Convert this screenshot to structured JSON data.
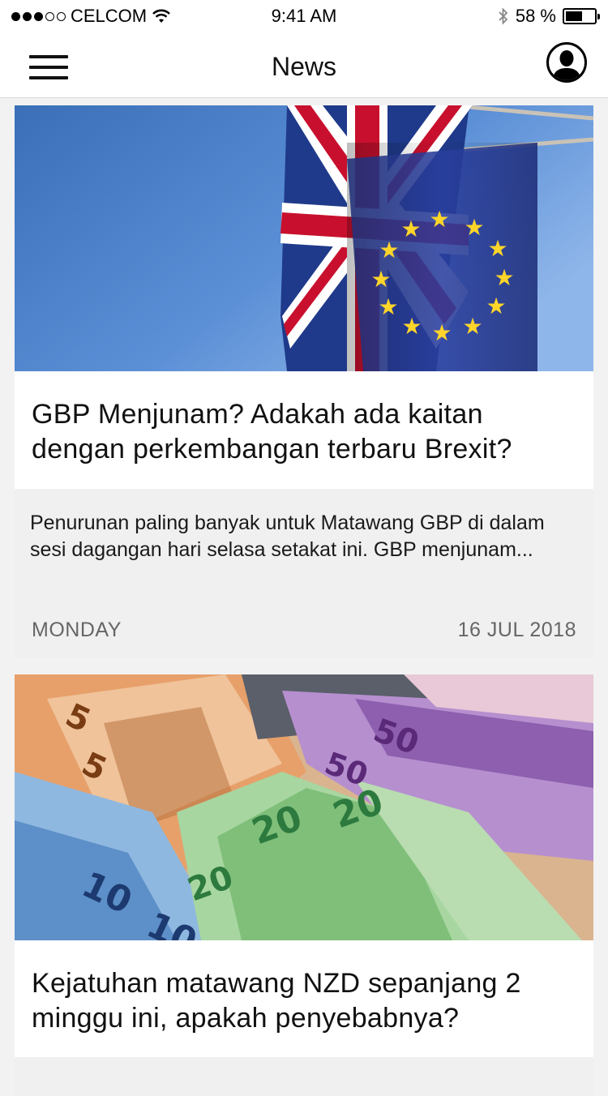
{
  "status_bar": {
    "carrier": "CELCOM",
    "time": "9:41 AM",
    "battery_percent": "58 %",
    "battery_level": 0.58,
    "signal_bars_filled": 3,
    "signal_bars_total": 5,
    "icons": [
      "wifi-icon",
      "bluetooth-icon",
      "battery-icon"
    ]
  },
  "header": {
    "title": "News",
    "menu_icon": "hamburger-menu-icon",
    "profile_icon": "user-profile-icon"
  },
  "articles": [
    {
      "image": "uk-eu-flags-photo",
      "title": "GBP Menjunam? Adakah ada kaitan dengan perkembangan terbaru Brexit?",
      "excerpt": "Penurunan paling banyak untuk Matawang GBP di dalam sesi dagangan hari selasa setakat ini. GBP menjunam...",
      "day": "MONDAY",
      "date": "16 JUL 2018"
    },
    {
      "image": "nzd-banknotes-photo",
      "title": "Kejatuhan matawang NZD sepanjang 2 minggu ini, apakah penyebabnya?"
    }
  ],
  "colors": {
    "background": "#f2f2f2",
    "card": "#ffffff",
    "card_footer": "#f0f0f0",
    "meta_text": "#666666"
  }
}
